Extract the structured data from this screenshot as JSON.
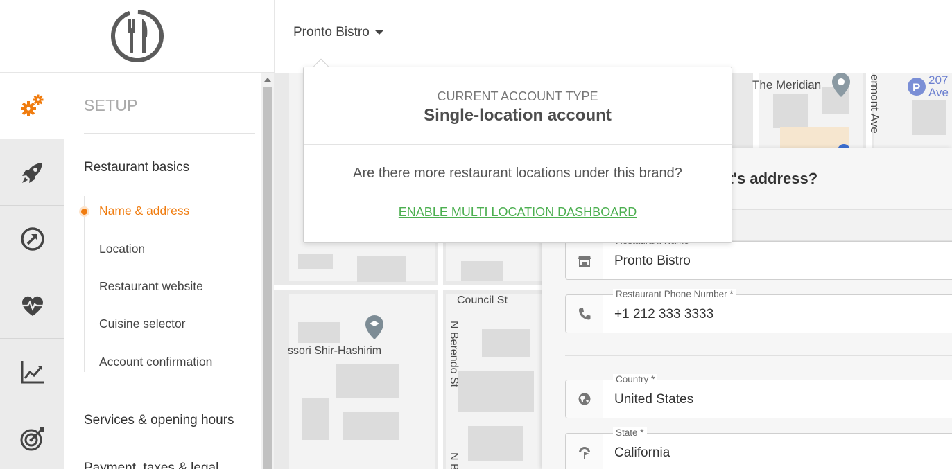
{
  "header": {
    "logo_icon": "fork-knife-icon",
    "brand_name": "Pronto Bistro"
  },
  "rail": {
    "items": [
      {
        "icon": "gears-icon",
        "active": true
      },
      {
        "icon": "rocket-icon"
      },
      {
        "icon": "growth-arrow-icon"
      },
      {
        "icon": "heart-pulse-icon"
      },
      {
        "icon": "line-chart-icon"
      },
      {
        "icon": "target-icon"
      }
    ]
  },
  "setup": {
    "title": "SETUP",
    "sections": [
      {
        "label": "Restaurant basics"
      },
      {
        "label": "Services & opening hours"
      },
      {
        "label": "Payment, taxes & legal"
      }
    ],
    "sub_items": [
      {
        "label": "Name & address",
        "active": true
      },
      {
        "label": "Location"
      },
      {
        "label": "Restaurant website"
      },
      {
        "label": "Cuisine selector"
      },
      {
        "label": "Account confirmation"
      }
    ]
  },
  "map": {
    "labels": {
      "meridian": "The Meridian",
      "vermont": "ermont Ave",
      "parking": "207 Ave",
      "council": "Council St",
      "school": "ssori Shir-Hashirim",
      "berendo": "N Berendo St",
      "berendo2": "N B"
    }
  },
  "popover": {
    "kicker": "CURRENT ACCOUNT TYPE",
    "type": "Single-location account",
    "question": "Are there more restaurant locations under this brand?",
    "link": "ENABLE MULTI LOCATION DASHBOARD"
  },
  "form": {
    "question": "nt's address?",
    "fields": [
      {
        "label": "Restaurant Name",
        "value": "Pronto Bistro",
        "icon": "store-icon"
      },
      {
        "label": "Restaurant Phone Number *",
        "value": "+1 212 333 3333",
        "icon": "phone-icon"
      },
      {
        "label": "Country *",
        "value": "United States",
        "icon": "globe-icon"
      },
      {
        "label": "State *",
        "value": "California",
        "icon": "map-flag-icon"
      }
    ]
  },
  "colors": {
    "accent": "#f07c0f",
    "link": "#4caf50"
  }
}
